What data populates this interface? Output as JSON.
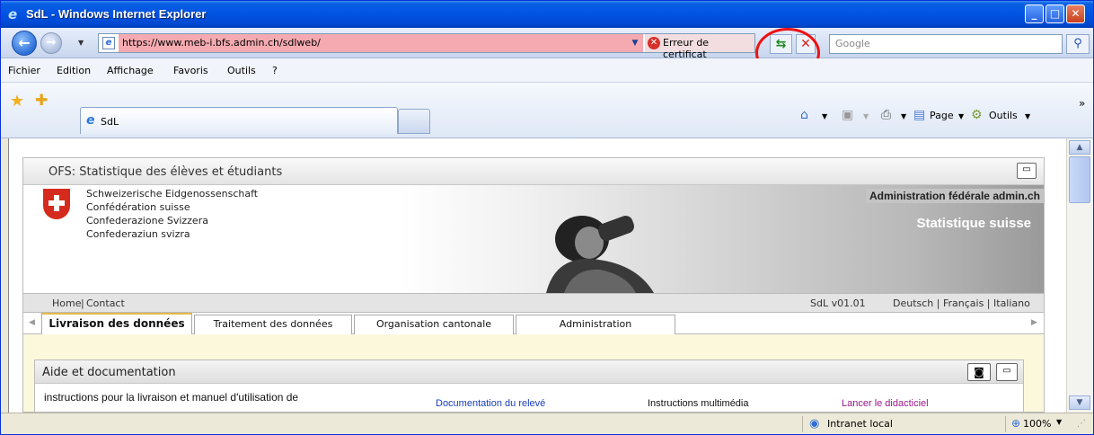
{
  "window": {
    "title": "SdL - Windows Internet Explorer",
    "minimize": "_",
    "maximize": "□",
    "close": "✕"
  },
  "address": {
    "url": "https://www.meb-i.bfs.admin.ch/sdlweb/",
    "cert_error": "Erreur de certificat",
    "search_placeholder": "Google"
  },
  "menu": [
    "Fichier",
    "Edition",
    "Affichage",
    "Favoris",
    "Outils",
    "?"
  ],
  "tab": {
    "label": "SdL"
  },
  "commandbar": {
    "page": "Page",
    "tools": "Outils"
  },
  "app": {
    "title": "OFS: Statistique des élèves et étudiants",
    "confederation": [
      "Schweizerische Eidgenossenschaft",
      "Confédération suisse",
      "Confederazione Svizzera",
      "Confederaziun svizra"
    ],
    "admin_label": "Administration fédérale admin.ch",
    "stat_label": "Statistique suisse",
    "home": "Home",
    "contact": "Contact",
    "version": "SdL v01.01",
    "languages": "Deutsch | Français | Italiano",
    "tabs": [
      "Livraison des données",
      "Traitement des données",
      "Organisation cantonale",
      "Administration"
    ],
    "aide": {
      "title": "Aide et documentation",
      "text": "instructions pour la livraison et manuel d'utilisation de",
      "links": [
        "Documentation du relevé",
        "Instructions multimédia",
        "Lancer le didacticiel"
      ]
    }
  },
  "status": {
    "zone": "Intranet local",
    "zoom": "100%"
  },
  "colors": {
    "titlebar": "#0054e3",
    "cert_bg": "#f4aab0",
    "link": "#1a3fbd",
    "link_visited": "#9b1a8a",
    "annotation": "#ee1111"
  }
}
